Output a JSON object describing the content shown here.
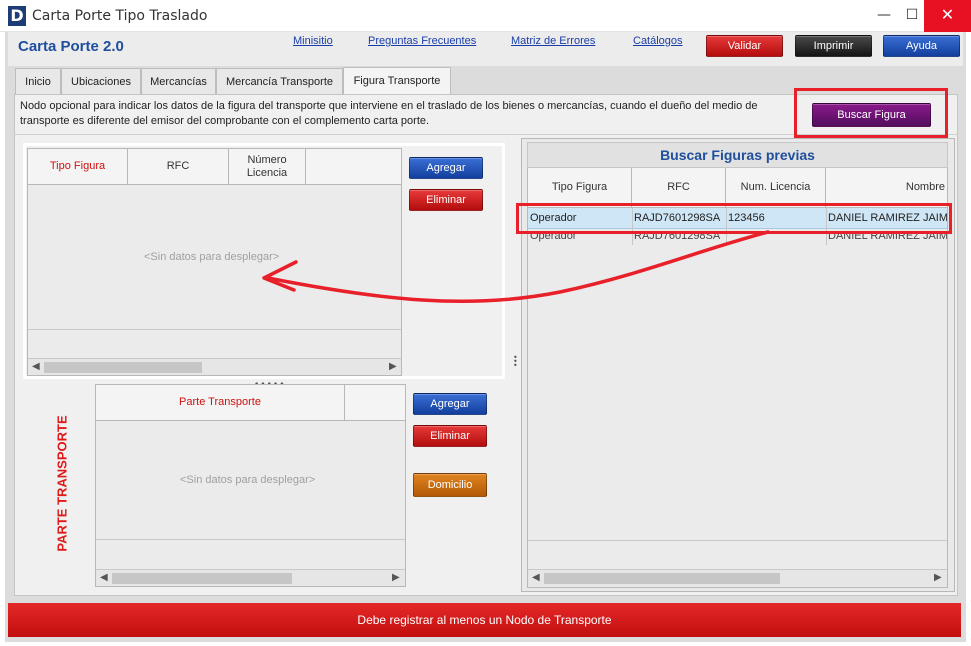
{
  "window": {
    "logo_letter": "D",
    "title": "Carta Porte Tipo Traslado",
    "minimize_glyph": "—",
    "maximize_glyph": "☐",
    "close_glyph": "✕"
  },
  "header": {
    "app_title": "Carta Porte 2.0",
    "links": [
      "Minisitio",
      "Preguntas Frecuentes",
      "Matriz de Errores",
      "Catálogos"
    ],
    "buttons": {
      "validar": "Validar",
      "imprimir": "Imprimir",
      "ayuda": "Ayuda"
    }
  },
  "tabs": [
    {
      "label": "Inicio"
    },
    {
      "label": "Ubicaciones"
    },
    {
      "label": "Mercancías"
    },
    {
      "label": "Mercancía Transporte"
    },
    {
      "label": "Figura Transporte",
      "active": true
    }
  ],
  "description": "Nodo opcional para indicar los datos de la figura del transporte que interviene en el traslado de los bienes o mercancías, cuando el dueño del medio de transporte es diferente del emisor del comprobante con el complemento carta porte.",
  "buscar_figura_button": "Buscar Figura",
  "figura_grid": {
    "columns": [
      "Tipo Figura",
      "RFC",
      "Número Licencia"
    ],
    "empty_text": "<Sin datos para desplegar>",
    "agregar": "Agregar",
    "eliminar": "Eliminar"
  },
  "parte_section": {
    "side_title": "PARTE TRANSPORTE",
    "columns": [
      "Parte Transporte"
    ],
    "empty_text": "<Sin datos para desplegar>",
    "agregar": "Agregar",
    "eliminar": "Eliminar",
    "domicilio": "Domicilio"
  },
  "buscar_previas": {
    "title": "Buscar Figuras previas",
    "columns": [
      "Tipo Figura",
      "RFC",
      "Num. Licencia",
      "Nombre"
    ],
    "rows": [
      {
        "tipo": "Operador",
        "rfc": "RAJD7601298SA",
        "licencia": "123456",
        "nombre": "DANIEL RAMIREZ JAIME"
      },
      {
        "tipo": "Operador",
        "rfc": "RAJD7601298SA",
        "licencia": "",
        "nombre": "DANIEL RAMIREZ JAIME"
      }
    ]
  },
  "status_bar": "Debe registrar al menos un Nodo de Transporte",
  "colors": {
    "accent_blue": "#1f4e9c",
    "highlight_red": "#e8202a",
    "selected_row": "#cfe6f6"
  }
}
